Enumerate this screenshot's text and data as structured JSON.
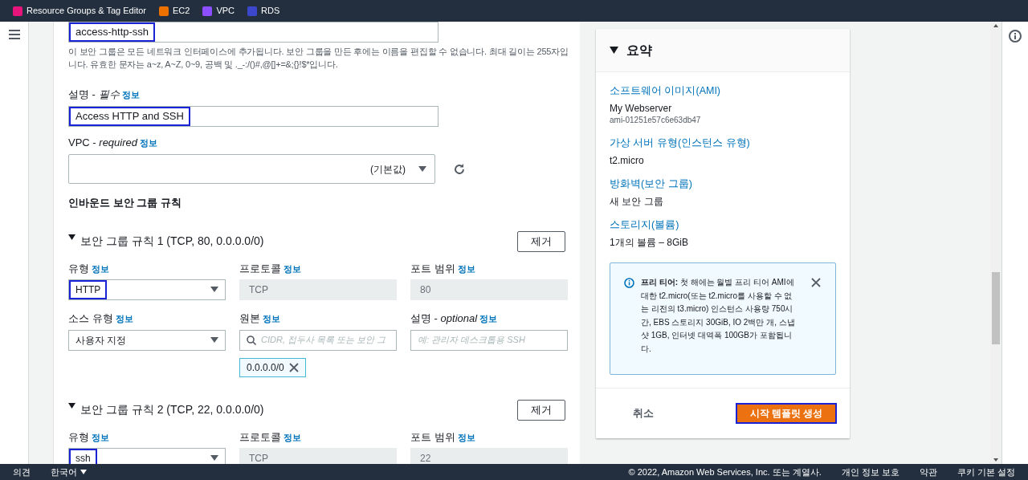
{
  "top_bar": {
    "services": [
      {
        "label": "Resource Groups & Tag Editor",
        "color": "#e7157b"
      },
      {
        "label": "EC2",
        "color": "#ed7100"
      },
      {
        "label": "VPC",
        "color": "#8c4fff"
      },
      {
        "label": "RDS",
        "color": "#3b48cc"
      }
    ]
  },
  "form": {
    "name_field": {
      "value": "access-http-ssh",
      "highlighted": true
    },
    "name_hint": "이 보안 그룹은 모든 네트워크 인터페이스에 추가됩니다. 보안 그룹을 만든 후에는 이름을 편집할 수 없습니다. 최대 길이는 255자입니다. 유효한 문자는 a~z, A~Z, 0~9, 공백 및 ._-:/()#,@[]+=&;{}!$*입니다.",
    "description": {
      "label": "설명 - *필수*",
      "info": "정보",
      "value": "Access HTTP and SSH",
      "highlighted": true
    },
    "vpc": {
      "label": "VPC - *required*",
      "info": "정보",
      "value": "(기본값)"
    },
    "rules_heading": "인바운드 보안 그룹 규칙",
    "rules": [
      {
        "title": "보안 그룹 규칙 1 (TCP, 80, 0.0.0.0/0)",
        "expanded": true,
        "remove": "제거",
        "fields": [
          {
            "kind": "select",
            "label": "유형",
            "info": "정보",
            "value": "HTTP",
            "highlighted": true
          },
          {
            "kind": "readonly",
            "label": "프로토콜",
            "info": "정보",
            "value": "TCP"
          },
          {
            "kind": "readonly",
            "label": "포트 범위",
            "info": "정보",
            "value": "80"
          },
          {
            "kind": "select",
            "label": "소스 유형",
            "info": "정보",
            "value": "사용자 지정",
            "highlighted": false
          },
          {
            "kind": "search",
            "label": "원본",
            "info": "정보",
            "placeholder": "CIDR, 접두사 목록 또는 보안 그",
            "chips": [
              "0.0.0.0/0"
            ]
          },
          {
            "kind": "text",
            "label": "설명 - *optional*",
            "info": "정보",
            "placeholder": "예: 관리자 데스크톱용 SSH"
          }
        ]
      },
      {
        "title": "보안 그룹 규칙 2 (TCP, 22, 0.0.0.0/0)",
        "expanded": true,
        "remove": "제거",
        "fields": [
          {
            "kind": "select",
            "label": "유형",
            "info": "정보",
            "value": "ssh",
            "highlighted": true
          },
          {
            "kind": "readonly",
            "label": "프로토콜",
            "info": "정보",
            "value": "TCP"
          },
          {
            "kind": "readonly",
            "label": "포트 범위",
            "info": "정보",
            "value": "22"
          }
        ]
      }
    ]
  },
  "summary": {
    "title": "요약",
    "expanded": true,
    "sections": [
      {
        "heading": "소프트웨어 이미지(AMI)",
        "lines": [
          {
            "kind": "main",
            "text": "My Webserver"
          },
          {
            "kind": "sub",
            "text": "ami-01251e57c6e63db47"
          }
        ]
      },
      {
        "heading": "가상 서버 유형(인스턴스 유형)",
        "lines": [
          {
            "kind": "main",
            "text": "t2.micro"
          }
        ]
      },
      {
        "heading": "방화벽(보안 그룹)",
        "lines": [
          {
            "kind": "main",
            "text": "새 보안 그룹"
          }
        ]
      },
      {
        "heading": "스토리지(볼륨)",
        "lines": [
          {
            "kind": "main",
            "text": "1개의 볼륨 – 8GiB"
          }
        ]
      }
    ],
    "alert": "**프리 티어:** 첫 해에는 월별 프리 티어 AMI에 대한 t2.micro(또는 t2.micro를 사용할 수 없는 리전의 t3.micro) 인스턴스 사용량 750시간, EBS 스토리지 30GiB, IO 2백만 개, 스냅샷 1GB, 인터넷 대역폭 100GB가 포함됩니다.",
    "cancel": "취소",
    "create": {
      "label": "시작 템플릿 생성",
      "highlighted": true
    }
  },
  "footer": {
    "feedback": "의견",
    "language": "한국어",
    "copyright": "© 2022, Amazon Web Services, Inc. 또는 계열사.",
    "links": [
      "개인 정보 보호",
      "약관",
      "쿠키 기본 설정"
    ]
  }
}
